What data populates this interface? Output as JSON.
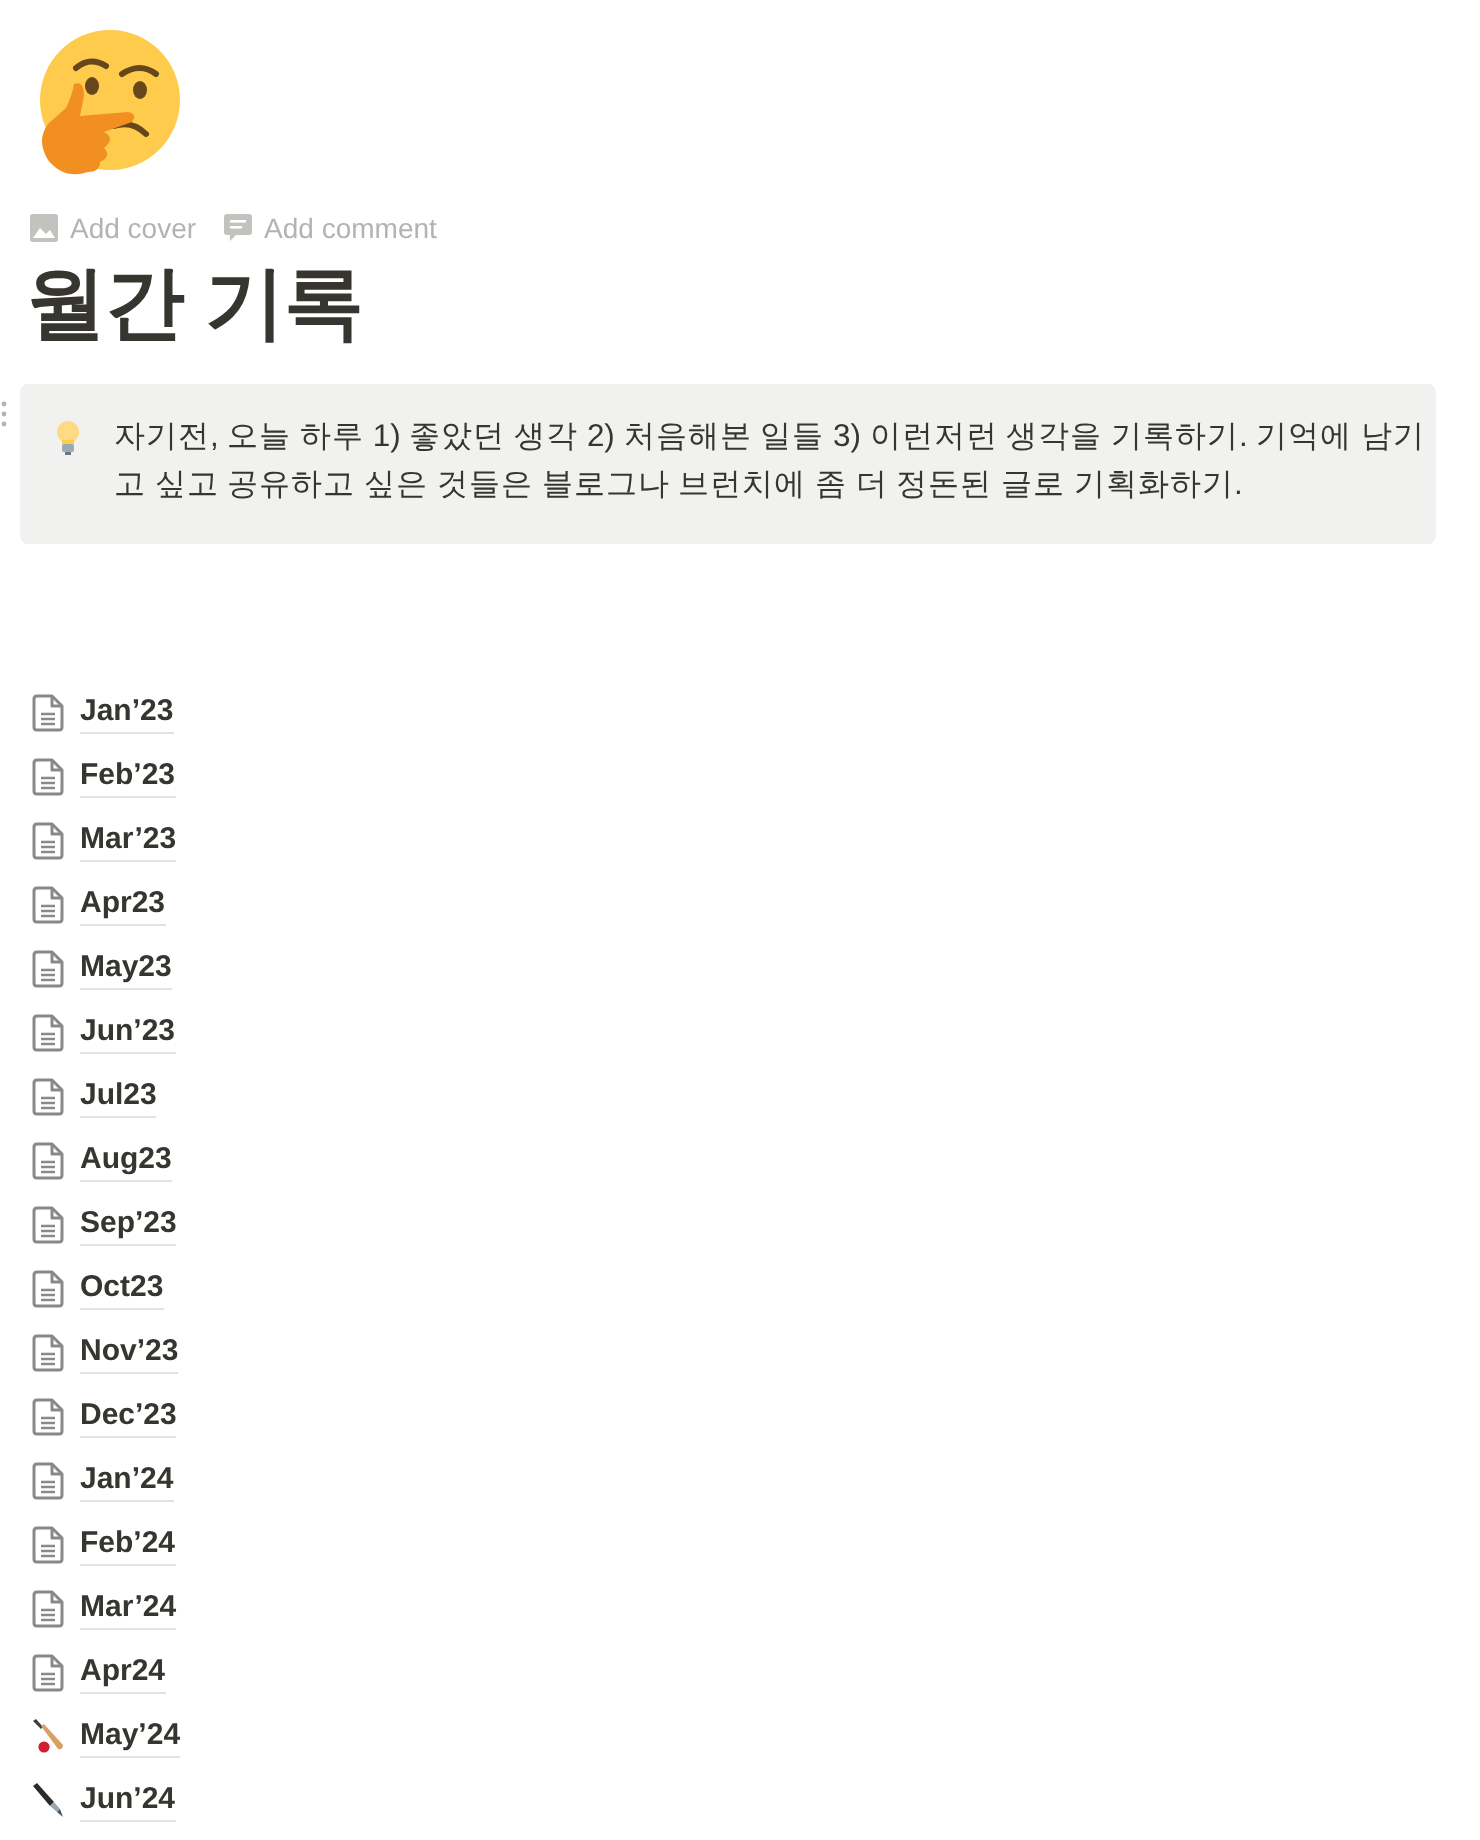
{
  "page_actions": [
    {
      "kind": "cover",
      "label": "Add cover"
    },
    {
      "kind": "comment",
      "label": "Add comment"
    }
  ],
  "title": "월간 기록",
  "callout": {
    "text": "자기전, 오늘 하루 1) 좋았던 생각 2) 처음해본 일들 3) 이런저런 생각을 기록하기. 기억에 남기고 싶고 공유하고 싶은 것들은 블로그나 브런치에 좀 더 정돈된 글로 기획화하기."
  },
  "pages": [
    {
      "label": "Jan’23",
      "kind": "page"
    },
    {
      "label": "Feb’23",
      "kind": "page"
    },
    {
      "label": "Mar’23",
      "kind": "page"
    },
    {
      "label": "Apr23",
      "kind": "page"
    },
    {
      "label": "May23",
      "kind": "page"
    },
    {
      "label": "Jun’23",
      "kind": "page"
    },
    {
      "label": "Jul23",
      "kind": "page"
    },
    {
      "label": "Aug23",
      "kind": "page"
    },
    {
      "label": "Sep’23",
      "kind": "page"
    },
    {
      "label": "Oct23",
      "kind": "page"
    },
    {
      "label": "Nov’23",
      "kind": "page"
    },
    {
      "label": "Dec’23",
      "kind": "page"
    },
    {
      "label": "Jan’24",
      "kind": "page"
    },
    {
      "label": "Feb’24",
      "kind": "page"
    },
    {
      "label": "Mar’24",
      "kind": "page"
    },
    {
      "label": "Apr24",
      "kind": "page"
    },
    {
      "label": "May’24",
      "kind": "bat"
    },
    {
      "label": "Jun’24",
      "kind": "pen"
    }
  ]
}
